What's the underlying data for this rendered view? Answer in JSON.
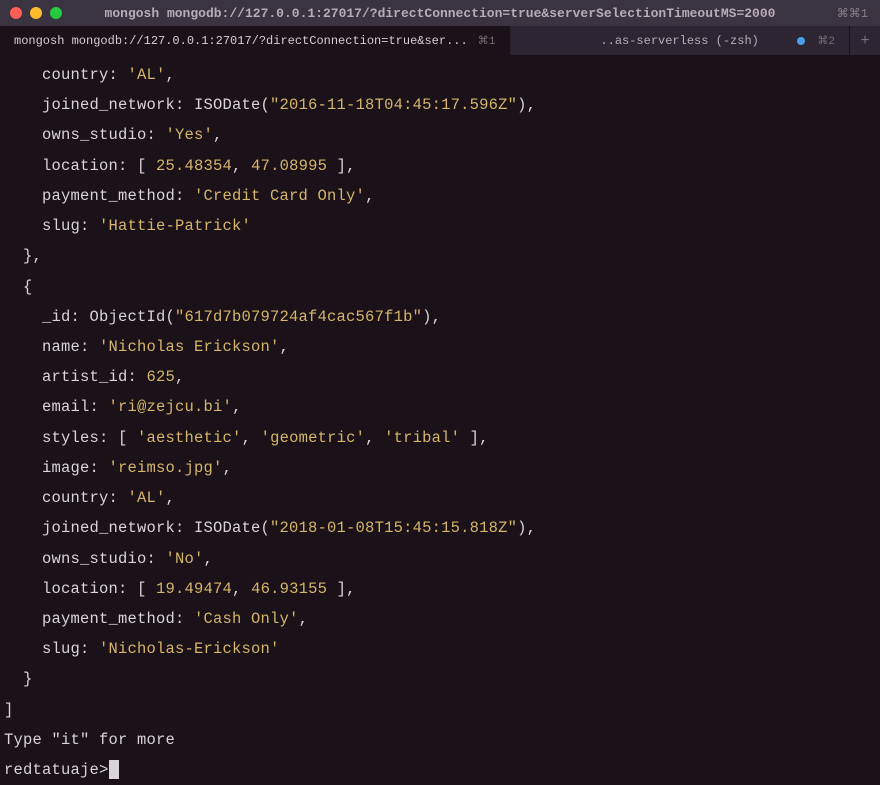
{
  "window": {
    "title": "mongosh mongodb://127.0.0.1:27017/?directConnection=true&serverSelectionTimeoutMS=2000",
    "shortcut": "⌘⌘1"
  },
  "tabs": {
    "t1": {
      "label": "mongosh mongodb://127.0.0.1:27017/?directConnection=true&ser...",
      "shortcut": "⌘1"
    },
    "t2": {
      "label": "..as-serverless (-zsh)",
      "shortcut": "⌘2"
    },
    "newTab": "+"
  },
  "code": {
    "r1_country_k": "    country: ",
    "r1_country_v": "'AL'",
    "r1_joined_k": "    joined_network: ISODate(",
    "r1_joined_v": "\"2016-11-18T04:45:17.596Z\"",
    "r1_joined_e": "),",
    "r1_owns_k": "    owns_studio: ",
    "r1_owns_v": "'Yes'",
    "r1_loc_k": "    location: [ ",
    "r1_loc_v1": "25.48354",
    "r1_loc_sep": ", ",
    "r1_loc_v2": "47.08995",
    "r1_loc_e": " ],",
    "r1_pay_k": "    payment_method: ",
    "r1_pay_v": "'Credit Card Only'",
    "r1_slug_k": "    slug: ",
    "r1_slug_v": "'Hattie-Patrick'",
    "close1": "  },",
    "open2": "  {",
    "r2_id_k": "    _id: ObjectId(",
    "r2_id_v": "\"617d7b079724af4cac567f1b\"",
    "r2_id_e": "),",
    "r2_name_k": "    name: ",
    "r2_name_v": "'Nicholas Erickson'",
    "r2_artist_k": "    artist_id: ",
    "r2_artist_v": "625",
    "r2_email_k": "    email: ",
    "r2_email_v": "'ri@zejcu.bi'",
    "r2_styles_k": "    styles: [ ",
    "r2_styles_v1": "'aesthetic'",
    "r2_styles_v2": "'geometric'",
    "r2_styles_v3": "'tribal'",
    "r2_styles_e": " ],",
    "r2_image_k": "    image: ",
    "r2_image_v": "'reimso.jpg'",
    "r2_country_k": "    country: ",
    "r2_country_v": "'AL'",
    "r2_joined_k": "    joined_network: ISODate(",
    "r2_joined_v": "\"2018-01-08T15:45:15.818Z\"",
    "r2_joined_e": "),",
    "r2_owns_k": "    owns_studio: ",
    "r2_owns_v": "'No'",
    "r2_loc_k": "    location: [ ",
    "r2_loc_v1": "19.49474",
    "r2_loc_v2": "46.93155",
    "r2_loc_e": " ],",
    "r2_pay_k": "    payment_method: ",
    "r2_pay_v": "'Cash Only'",
    "r2_slug_k": "    slug: ",
    "r2_slug_v": "'Nicholas-Erickson'",
    "close2": "  }",
    "closeArr": "]",
    "itMore": "Type \"it\" for more",
    "prompt": "redtatuaje> ",
    "comma": ","
  }
}
